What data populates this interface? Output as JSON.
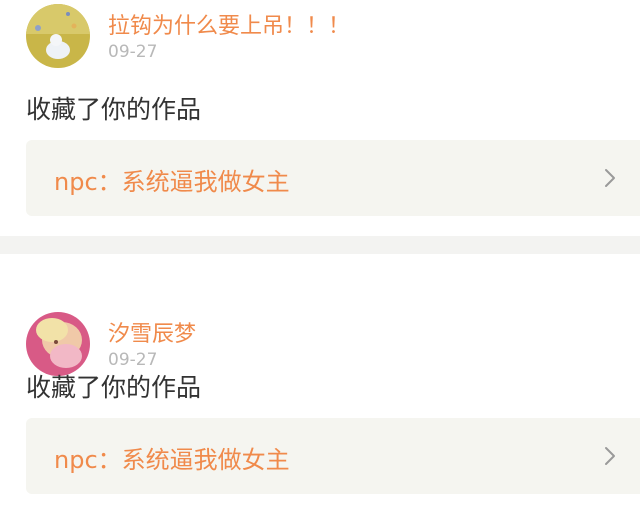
{
  "feed": {
    "items": [
      {
        "user": {
          "name": "拉钩为什么要上吊！！！",
          "avatar_icon": "avatar-icon"
        },
        "timestamp": "09-27",
        "action": "收藏了你的作品",
        "work": {
          "title": "npc：系统逼我做女主",
          "chevron_icon": "chevron-right-icon"
        }
      },
      {
        "user": {
          "name": "汐雪辰梦",
          "avatar_icon": "avatar-icon"
        },
        "timestamp": "09-27",
        "action": "收藏了你的作品",
        "work": {
          "title": "npc：系统逼我做女主",
          "chevron_icon": "chevron-right-icon"
        }
      }
    ]
  },
  "colors": {
    "accent": "#f08a4b",
    "text": "#333333",
    "muted": "#b8b8b8",
    "link_bg": "#f5f5f0",
    "divider": "#f3f3f1"
  }
}
